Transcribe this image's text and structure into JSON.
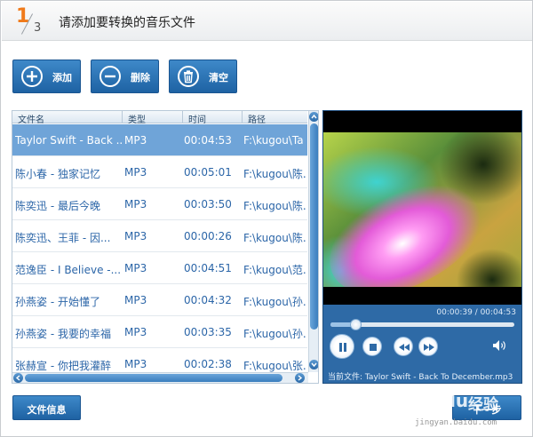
{
  "header": {
    "step_current": "1",
    "step_total": "3",
    "title": "请添加要转换的音乐文件"
  },
  "toolbar": {
    "add_label": "添加",
    "delete_label": "删除",
    "clear_label": "清空"
  },
  "table": {
    "columns": [
      "文件名",
      "类型",
      "时间",
      "路径"
    ],
    "rows": [
      {
        "name": "Taylor Swift - Back ...",
        "type": "MP3",
        "time": "00:04:53",
        "path": "F:\\kugou\\Ta"
      },
      {
        "name": "陈小春 - 独家记忆",
        "type": "MP3",
        "time": "00:05:01",
        "path": "F:\\kugou\\陈."
      },
      {
        "name": "陈奕迅 - 最后今晚",
        "type": "MP3",
        "time": "00:03:50",
        "path": "F:\\kugou\\陈."
      },
      {
        "name": "陈奕迅、王菲 - 因...",
        "type": "MP3",
        "time": "00:00:26",
        "path": "F:\\kugou\\陈."
      },
      {
        "name": "范逸臣 - I Believe -...",
        "type": "MP3",
        "time": "00:04:51",
        "path": "F:\\kugou\\范."
      },
      {
        "name": "孙燕姿 - 开始懂了",
        "type": "MP3",
        "time": "00:04:32",
        "path": "F:\\kugou\\孙."
      },
      {
        "name": "孙燕姿 - 我要的幸福",
        "type": "MP3",
        "time": "00:03:35",
        "path": "F:\\kugou\\孙."
      },
      {
        "name": "张赫宣 - 你把我灌醉",
        "type": "MP3",
        "time": "00:02:38",
        "path": "F:\\kugou\\张."
      }
    ],
    "selected_index": 0
  },
  "player": {
    "time_display": "00:00:39 / 00:04:53",
    "progress": 0.133,
    "current_file": "当前文件: Taylor Swift - Back To December.mp3"
  },
  "footer": {
    "file_info_label": "文件信息",
    "next_label": "下一步"
  },
  "watermark": {
    "brand": "Baidu",
    "brand_cn": "经验",
    "url": "jingyan.baidu.com"
  },
  "colors": {
    "accent": "#1e62a3",
    "selected_row": "#6fa4d8",
    "step_number": "#f07a1a",
    "row_text": "#2c66a8"
  },
  "icons": {
    "add": "plus-circle-icon",
    "delete": "minus-circle-icon",
    "clear": "trash-icon",
    "play_pause": "pause-icon",
    "stop": "stop-icon",
    "prev": "rewind-icon",
    "next": "fast-forward-icon",
    "volume": "speaker-icon"
  }
}
